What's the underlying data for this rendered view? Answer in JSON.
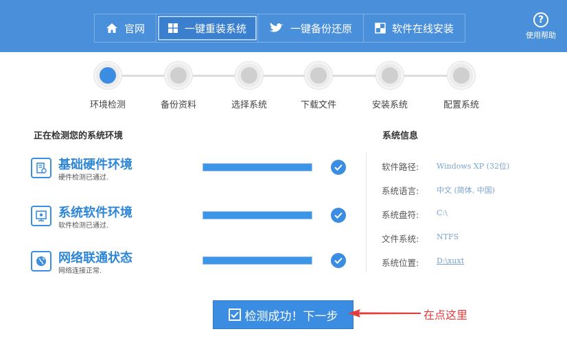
{
  "nav": {
    "tabs": [
      {
        "label": "官网",
        "icon": "home-icon"
      },
      {
        "label": "一键重装系统",
        "icon": "windows-icon",
        "active": true
      },
      {
        "label": "一键备份还原",
        "icon": "bird-icon"
      },
      {
        "label": "软件在线安装",
        "icon": "apps-icon"
      }
    ],
    "help_label": "使用帮助",
    "help_icon": "help-icon"
  },
  "steps": [
    {
      "label": "环境检测",
      "active": true
    },
    {
      "label": "备份资料"
    },
    {
      "label": "选择系统"
    },
    {
      "label": "下载文件"
    },
    {
      "label": "安装系统"
    },
    {
      "label": "配置系统"
    }
  ],
  "detect": {
    "title": "正在检测您的系统环境",
    "items": [
      {
        "title": "基础硬件环境",
        "sub": "硬件检测已通过.",
        "icon": "hardware-icon",
        "progress": 1.0
      },
      {
        "title": "系统软件环境",
        "sub": "软件检测已通过.",
        "icon": "monitor-icon",
        "progress": 1.0
      },
      {
        "title": "网络联通状态",
        "sub": "网络连接正常.",
        "icon": "network-icon",
        "progress": 1.0
      }
    ]
  },
  "sysinfo": {
    "title": "系统信息",
    "rows": [
      {
        "label": "软件路径:",
        "value": "Windows XP (32位)"
      },
      {
        "label": "系统语言:",
        "value": "中文 (简体, 中国)"
      },
      {
        "label": "系统盘符:",
        "value": "C:\\"
      },
      {
        "label": "文件系统:",
        "value": "NTFS"
      },
      {
        "label": "系统位置:",
        "value": "D:\\xuxt"
      }
    ]
  },
  "next_button": "检测成功！下一步",
  "annotation": "在点这里",
  "colors": {
    "accent": "#3a8de0",
    "topbar": "#4a8fd9",
    "annotation": "#e23b3b"
  }
}
